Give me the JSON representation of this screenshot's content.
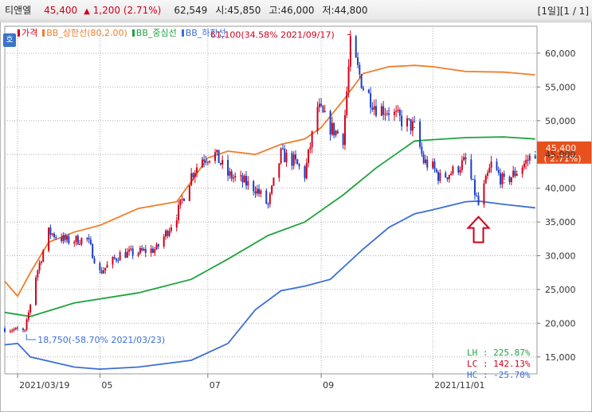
{
  "header": {
    "stock_name": "티앤엘",
    "price": "45,400",
    "change_arrow": "▲",
    "change": "1,200 (2.71%)",
    "volume": "62,549",
    "open": "시:45,850",
    "high": "고:46,000",
    "low": "저:44,800",
    "period": "[1일][1 / 1]"
  },
  "ho_button": "호",
  "legend": [
    {
      "label": "가격",
      "color": "#d0021b"
    },
    {
      "label": "BB_상한선(80,2.00)",
      "color": "#f07d2a"
    },
    {
      "label": "BB_중심선",
      "color": "#1fa33f"
    },
    {
      "label": "BB_하한선",
      "color": "#3b6fd4"
    }
  ],
  "annotations": {
    "high_note": "61,100(34.58% 2021/09/17)",
    "low_note": "18,750(-58.70% 2021/03/23)"
  },
  "price_tag": {
    "price": "45,400",
    "pct": "( 2.71%)"
  },
  "stats": [
    {
      "label": "LH",
      "value": "225.87%",
      "color": "#1fa33f"
    },
    {
      "label": "LC",
      "value": "142.13%",
      "color": "#d0021b"
    },
    {
      "label": "HC",
      "value": "-25.70%",
      "color": "#3b6fd4"
    }
  ],
  "colors": {
    "up": "#d0021b",
    "down": "#1e3fc0",
    "upper": "#f07d2a",
    "mid": "#1fa33f",
    "lower": "#3b6fd4",
    "grid": "#b0b0b0",
    "marker": "#d0021b"
  },
  "chart_data": {
    "type": "line",
    "title": "",
    "xlabel": "",
    "ylabel": "",
    "ylim": [
      12500,
      64000
    ],
    "y_ticks": [
      15000,
      20000,
      25000,
      30000,
      35000,
      40000,
      45000,
      50000,
      55000,
      60000
    ],
    "y_tick_labels": [
      "15,000",
      "20,000",
      "25,000",
      "30,000",
      "35,000",
      "40,000",
      "45,000",
      "50,000",
      "55,000",
      "60,000"
    ],
    "x_ticks": [
      {
        "date": "2021-03-19",
        "label": "2021/03/19"
      },
      {
        "date": "2021-05-03",
        "label": "05"
      },
      {
        "date": "2021-07-01",
        "label": "07"
      },
      {
        "date": "2021-09-01",
        "label": "09"
      },
      {
        "date": "2021-11-01",
        "label": "2021/11/01"
      }
    ],
    "x_range": [
      "2021-03-12",
      "2021-12-28"
    ],
    "grid": true,
    "legend_position": "top-left",
    "series": [
      {
        "name": "가격",
        "x": [
          "2021-03-12",
          "2021-03-19",
          "2021-03-23",
          "2021-03-29",
          "2021-04-05",
          "2021-04-15",
          "2021-04-26",
          "2021-05-03",
          "2021-05-14",
          "2021-05-24",
          "2021-06-03",
          "2021-06-14",
          "2021-06-22",
          "2021-06-28",
          "2021-07-05",
          "2021-07-12",
          "2021-07-20",
          "2021-07-27",
          "2021-08-03",
          "2021-08-10",
          "2021-08-17",
          "2021-08-23",
          "2021-08-30",
          "2021-09-06",
          "2021-09-13",
          "2021-09-17",
          "2021-09-24",
          "2021-10-01",
          "2021-10-08",
          "2021-10-15",
          "2021-10-22",
          "2021-10-27",
          "2021-11-01",
          "2021-11-05",
          "2021-11-12",
          "2021-11-19",
          "2021-11-26",
          "2021-12-03",
          "2021-12-10",
          "2021-12-17",
          "2021-12-23",
          "2021-12-27"
        ],
        "values": [
          19200,
          19000,
          18750,
          27000,
          33500,
          32200,
          32500,
          27500,
          30200,
          30500,
          31000,
          36000,
          42000,
          44500,
          45000,
          42000,
          41000,
          40000,
          37500,
          45000,
          44000,
          42000,
          52000,
          49000,
          47500,
          61100,
          55000,
          52000,
          51500,
          50000,
          49000,
          44000,
          43000,
          41500,
          42500,
          44000,
          37500,
          43500,
          40800,
          42500,
          44200,
          45400
        ]
      },
      {
        "name": "BB_상한선(80,2.00)",
        "x": [
          "2021-03-12",
          "2021-03-19",
          "2021-03-26",
          "2021-04-05",
          "2021-04-19",
          "2021-05-03",
          "2021-05-24",
          "2021-06-14",
          "2021-06-22",
          "2021-07-01",
          "2021-07-12",
          "2021-07-27",
          "2021-08-10",
          "2021-08-23",
          "2021-09-01",
          "2021-09-13",
          "2021-09-24",
          "2021-10-08",
          "2021-10-22",
          "2021-11-01",
          "2021-11-19",
          "2021-12-10",
          "2021-12-27"
        ],
        "values": [
          26200,
          24000,
          27500,
          32000,
          33500,
          34500,
          37000,
          38000,
          41000,
          44500,
          45500,
          45000,
          46500,
          47300,
          49000,
          53000,
          57000,
          58000,
          58200,
          58000,
          57300,
          57200,
          56800
        ]
      },
      {
        "name": "BB_중심선",
        "x": [
          "2021-03-12",
          "2021-03-26",
          "2021-04-19",
          "2021-05-24",
          "2021-06-22",
          "2021-07-12",
          "2021-08-03",
          "2021-08-23",
          "2021-09-13",
          "2021-10-01",
          "2021-10-22",
          "2021-11-01",
          "2021-11-19",
          "2021-12-10",
          "2021-12-27"
        ],
        "values": [
          21600,
          21000,
          23000,
          24500,
          26500,
          29500,
          33000,
          35000,
          39000,
          43000,
          47000,
          47200,
          47500,
          47600,
          47300
        ]
      },
      {
        "name": "BB_하한선",
        "x": [
          "2021-03-12",
          "2021-03-19",
          "2021-03-26",
          "2021-04-19",
          "2021-05-03",
          "2021-05-24",
          "2021-06-22",
          "2021-07-12",
          "2021-07-27",
          "2021-08-10",
          "2021-08-23",
          "2021-09-06",
          "2021-09-24",
          "2021-10-08",
          "2021-10-22",
          "2021-11-01",
          "2021-11-19",
          "2021-11-26",
          "2021-12-10",
          "2021-12-27"
        ],
        "values": [
          16800,
          17000,
          15000,
          13500,
          13200,
          13500,
          14500,
          17000,
          22000,
          24800,
          25500,
          26500,
          31000,
          34200,
          36200,
          36800,
          38000,
          38100,
          37600,
          37100
        ]
      }
    ]
  }
}
